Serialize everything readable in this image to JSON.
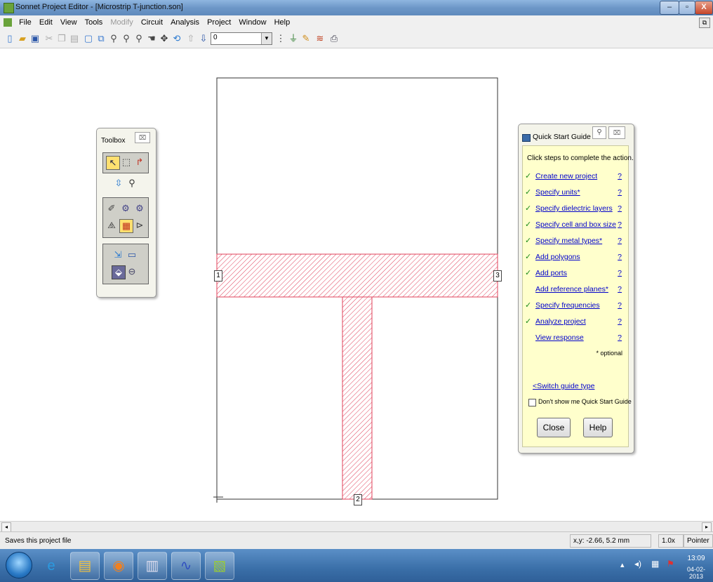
{
  "window": {
    "title": "Sonnet Project Editor - [Microstrip T-junction.son]",
    "min_glyph": "–",
    "max_glyph": "▫",
    "close_glyph": "X"
  },
  "menu": {
    "items": [
      {
        "label": "File",
        "enabled": true
      },
      {
        "label": "Edit",
        "enabled": true
      },
      {
        "label": "View",
        "enabled": true
      },
      {
        "label": "Tools",
        "enabled": true
      },
      {
        "label": "Modify",
        "enabled": false
      },
      {
        "label": "Circuit",
        "enabled": true
      },
      {
        "label": "Analysis",
        "enabled": true
      },
      {
        "label": "Project",
        "enabled": true
      },
      {
        "label": "Window",
        "enabled": true
      },
      {
        "label": "Help",
        "enabled": true
      }
    ],
    "restore_glyph": "⧉"
  },
  "toolbar": {
    "level_value": "0",
    "icons": [
      "new-file-icon",
      "open-folder-icon",
      "save-icon",
      "cut-icon",
      "copy-icon",
      "paste-icon",
      "new-view-icon",
      "pan-view-icon",
      "zoom-in-icon",
      "zoom-out-icon",
      "zoom-fit-icon",
      "hand-icon",
      "move-icon",
      "rotate-icon",
      "up-level-icon",
      "down-level-icon"
    ],
    "right_icons": [
      "grid-icon",
      "port-icon",
      "pencil-icon",
      "analyze-icon",
      "print-icon"
    ]
  },
  "toolbox": {
    "title": "Toolbox",
    "close_glyph": "⌧"
  },
  "circuit": {
    "port_labels": [
      "1",
      "3",
      "2"
    ]
  },
  "quick_start": {
    "title": "Quick Start Guide",
    "pin_glyph": "⚲",
    "close_glyph": "⌧",
    "instruction": "Click steps to complete the action.",
    "steps": [
      {
        "label": "Create new project",
        "done": true
      },
      {
        "label": "Specify units*",
        "done": true
      },
      {
        "label": "Specify dielectric layers",
        "done": true
      },
      {
        "label": "Specify cell and box size",
        "done": true
      },
      {
        "label": "Specify metal types*",
        "done": true
      },
      {
        "label": "Add polygons",
        "done": true
      },
      {
        "label": "Add ports",
        "done": true
      },
      {
        "label": "Add reference planes*",
        "done": false
      },
      {
        "label": "Specify frequencies",
        "done": true
      },
      {
        "label": "Analyze project",
        "done": true
      },
      {
        "label": "View response",
        "done": false
      }
    ],
    "help_glyph": "?",
    "optional_note": "* optional",
    "switch_link": "<Switch guide type",
    "dont_show_label": "Don't show me Quick Start Guide",
    "close_button": "Close",
    "help_button": "Help"
  },
  "status": {
    "message": "Saves this project file",
    "coords": "x,y: -2.66, 5.2 mm",
    "zoom": "1.0x",
    "mode": "Pointer"
  },
  "taskbar": {
    "time": "13:09",
    "date": "04-02-2013",
    "apps": [
      "internet-explorer-icon",
      "file-explorer-icon",
      "media-player-icon",
      "word-icon",
      "sonnet-viewer-icon",
      "sonnet-editor-icon"
    ]
  },
  "colors": {
    "metal_hatch": "#e0405a",
    "check": "#1a8a1a",
    "link": "#0000cc",
    "qsg_bg": "#ffffcc"
  }
}
